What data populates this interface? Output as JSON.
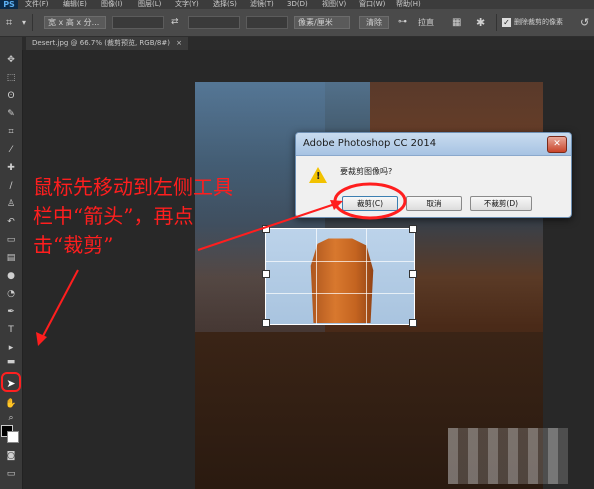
{
  "menubar": {
    "logo": "PS",
    "items": [
      "文件(F)",
      "编辑(E)",
      "图像(I)",
      "图层(L)",
      "文字(Y)",
      "选择(S)",
      "滤镜(T)",
      "3D(D)",
      "视图(V)",
      "窗口(W)",
      "帮助(H)"
    ]
  },
  "options": {
    "ratio_select": "宽 x 高 x 分...",
    "unit_select": "像素/厘米",
    "clear_button": "清除",
    "straighten_label": "拉直",
    "delete_cropped_label": "删除裁剪的像素"
  },
  "document_tab": {
    "label": "Desert.jpg @ 66.7% (裁剪预览, RGB/8#)",
    "close": "×"
  },
  "dialog": {
    "title": "Adobe Photoshop CC 2014",
    "close_glyph": "✕",
    "message": "要裁剪图像吗?",
    "buttons": {
      "crop": "裁剪(C)",
      "cancel": "取消",
      "dont_crop": "不裁剪(D)"
    }
  },
  "annotation": {
    "lines": [
      "鼠标先移动到左侧工具",
      "栏中“箭头”，再点",
      "击“裁剪”"
    ],
    "color": "#ff1e1e"
  },
  "tools": [
    "move-icon",
    "marquee-icon",
    "lasso-icon",
    "quick-select-icon",
    "crop-icon",
    "eyedropper-icon",
    "healing-icon",
    "brush-icon",
    "stamp-icon",
    "history-brush-icon",
    "eraser-icon",
    "gradient-icon",
    "blur-icon",
    "dodge-icon",
    "pen-icon",
    "type-icon",
    "path-select-icon",
    "shape-icon",
    "hand-icon",
    "zoom-icon"
  ]
}
